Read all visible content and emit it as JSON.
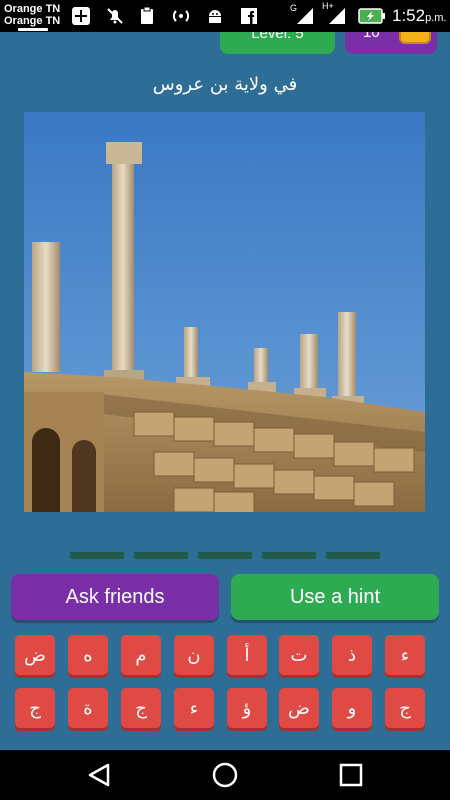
{
  "status_bar": {
    "carrier_line1": "Orange TN",
    "carrier_line2": "Orange TN",
    "signal_h_label": "H+",
    "signal_g_label": "G",
    "time": "1:52",
    "ampm": "p.m.",
    "icons": [
      "plus-icon",
      "mute-icon",
      "clipboard-icon",
      "hotspot-icon",
      "android-icon",
      "facebook-icon",
      "signal-icon",
      "signal-icon",
      "battery-charging-icon"
    ]
  },
  "header": {
    "level_label": "Level: 5",
    "coins": "10",
    "menu_icon": "hamburger-icon"
  },
  "puzzle": {
    "clue": "في ولاية بن عروس",
    "image_description_icon": "roman-ruins-image",
    "answer_slot_count": 5
  },
  "actions": {
    "ask_label": "Ask friends",
    "hint_label": "Use a hint"
  },
  "keyboard": {
    "row1": [
      "ض",
      "ه",
      "م",
      "ن",
      "أ",
      "ت",
      "ذ",
      "ء"
    ],
    "row2": [
      "ج",
      "ة",
      "ج",
      "ء",
      "ؤ",
      "ض",
      "و",
      "ج"
    ]
  },
  "nav": {
    "back_icon": "back-icon",
    "home_icon": "home-icon",
    "recents_icon": "recents-icon"
  },
  "colors": {
    "background": "#2e6e96",
    "green": "#2eaa53",
    "purple": "#7a2ea8",
    "key_red": "#e04a44",
    "slot": "#1f5a4c"
  }
}
